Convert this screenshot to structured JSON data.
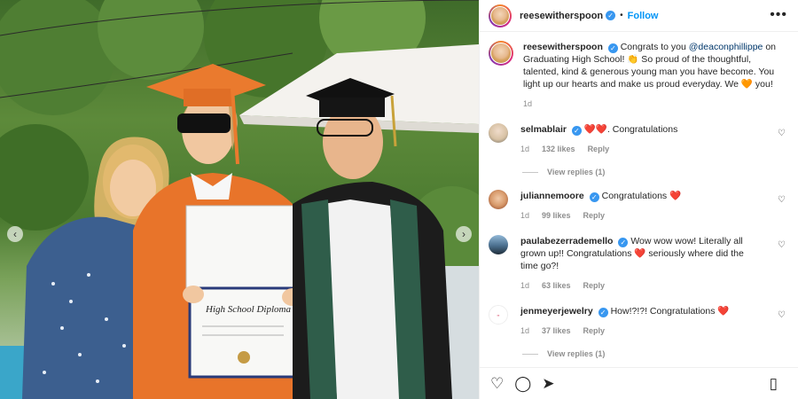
{
  "header": {
    "username": "reesewitherspoon",
    "separator": "•",
    "follow_label": "Follow",
    "more_icon": "more-horizontal-icon"
  },
  "caption": {
    "username": "reesewitherspoon",
    "text_before": "Congrats to you ",
    "mention": "@deaconphillippe",
    "text_after": " on Graduating High School! 👏 So proud of the thoughtful, talented, kind & generous young man you have become. You light up our hearts and make us proud everyday. We 🧡 you!",
    "time": "1d"
  },
  "comments": [
    {
      "username": "selmablair",
      "text": "❤️❤️. Congratulations",
      "time": "1d",
      "likes": "132 likes",
      "reply": "Reply",
      "view_replies": "View replies (1)"
    },
    {
      "username": "juliannemoore",
      "text": "Congratulations ❤️",
      "time": "1d",
      "likes": "99 likes",
      "reply": "Reply",
      "view_replies": ""
    },
    {
      "username": "paulabezerrademello",
      "text": "Wow wow wow! Literally all grown up!! Congratulations ❤️ seriously where did the time go?!",
      "time": "1d",
      "likes": "63 likes",
      "reply": "Reply",
      "view_replies": ""
    },
    {
      "username": "jenmeyerjewelry",
      "text": "How!?!?! Congratulations ❤️",
      "time": "1d",
      "likes": "37 likes",
      "reply": "Reply",
      "view_replies": "View replies (1)"
    }
  ],
  "actions": {
    "like_icon": "heart-icon",
    "comment_icon": "comment-icon",
    "share_icon": "send-icon",
    "save_icon": "bookmark-icon"
  },
  "photo": {
    "diploma_title": "High School Diploma"
  },
  "colors": {
    "accent_blue": "#0095f6",
    "verified_blue": "#3897f0",
    "gown_orange": "#e8742a"
  }
}
